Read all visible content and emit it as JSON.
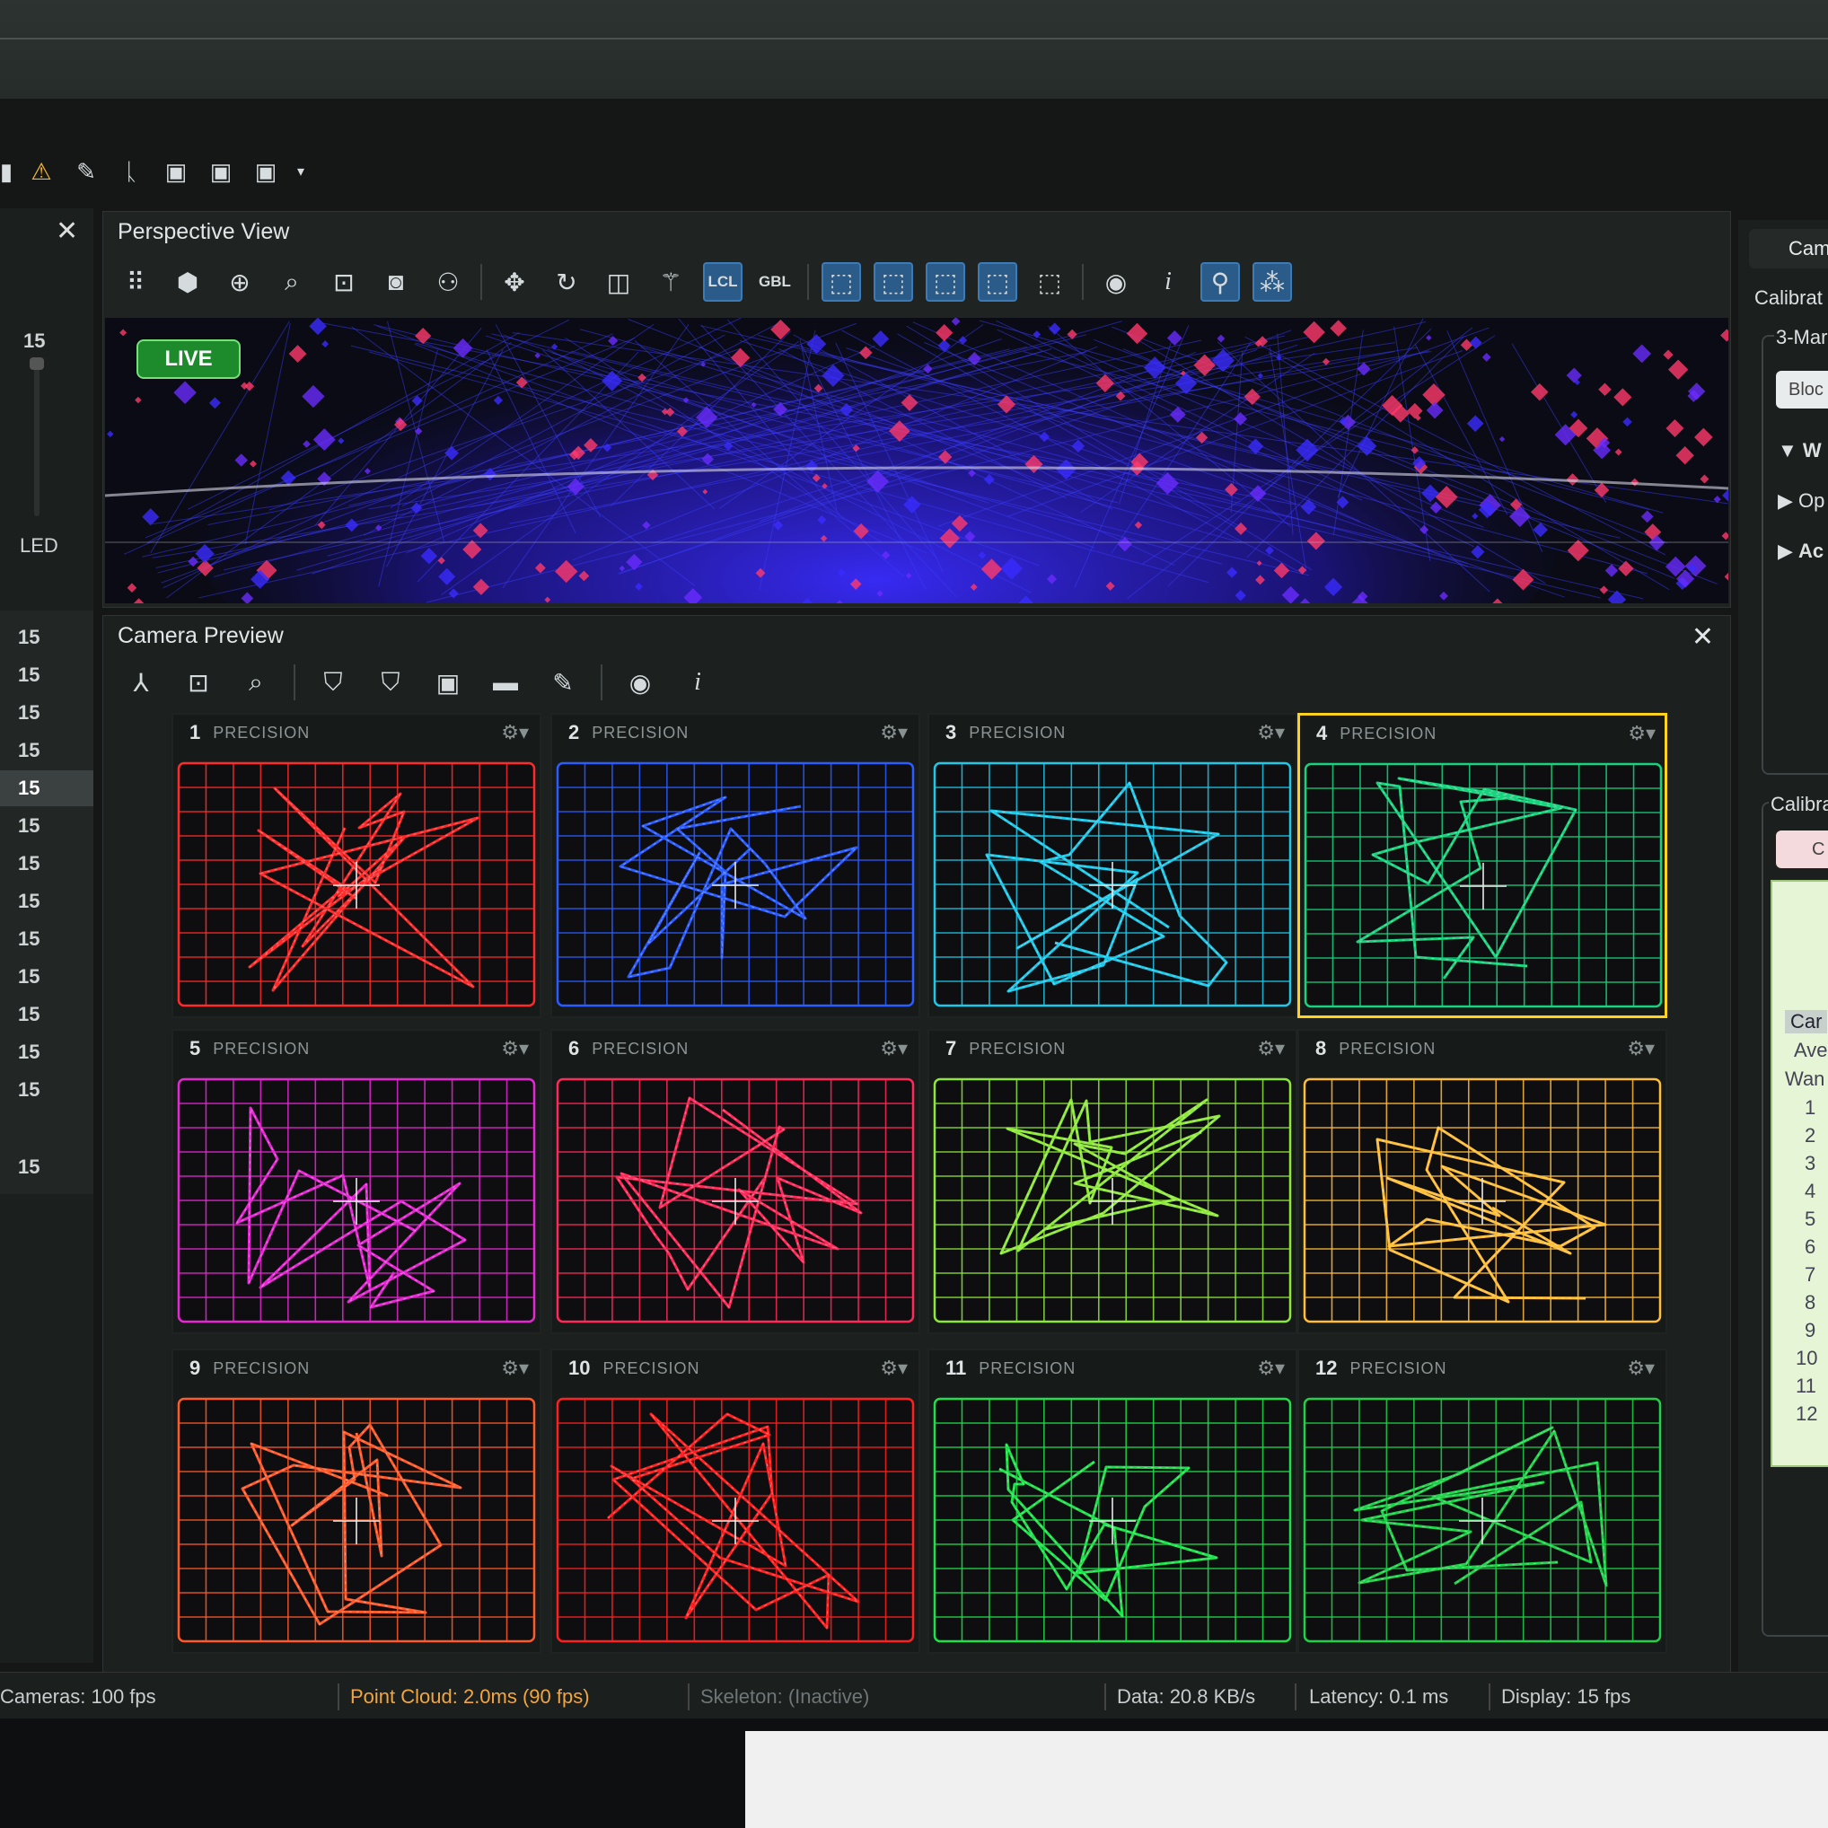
{
  "perspective": {
    "title": "Perspective View",
    "live": "LIVE",
    "lcl": "LCL",
    "gbl": "GBL"
  },
  "preview": {
    "title": "Camera Preview"
  },
  "left": {
    "top_value": "15",
    "led_label": "LED",
    "rows": [
      "15",
      "15",
      "15",
      "15",
      "15",
      "15",
      "15",
      "15",
      "15",
      "15",
      "15",
      "15",
      "15",
      "15"
    ],
    "selected_index": 4
  },
  "cameras": [
    {
      "num": "1",
      "mode": "PRECISION",
      "color": "#ff2a2a"
    },
    {
      "num": "2",
      "mode": "PRECISION",
      "color": "#2a5cff"
    },
    {
      "num": "3",
      "mode": "PRECISION",
      "color": "#1ec8e8"
    },
    {
      "num": "4",
      "mode": "PRECISION",
      "color": "#18d27e"
    },
    {
      "num": "5",
      "mode": "PRECISION",
      "color": "#e628d4"
    },
    {
      "num": "6",
      "mode": "PRECISION",
      "color": "#ff2a5a"
    },
    {
      "num": "7",
      "mode": "PRECISION",
      "color": "#8ee83a"
    },
    {
      "num": "8",
      "mode": "PRECISION",
      "color": "#ffbe3a"
    },
    {
      "num": "9",
      "mode": "PRECISION",
      "color": "#ff5a2a"
    },
    {
      "num": "10",
      "mode": "PRECISION",
      "color": "#ff2020"
    },
    {
      "num": "11",
      "mode": "PRECISION",
      "color": "#1ee04a"
    },
    {
      "num": "12",
      "mode": "PRECISION",
      "color": "#20d24a"
    }
  ],
  "selected_camera": 4,
  "right": {
    "tab": "Came",
    "calib1": "Calibrat",
    "group": "3-Mar",
    "btn1": "Bloc",
    "items": [
      "W",
      "Op",
      "Ac"
    ],
    "calib2": "Calibra",
    "btn2": "C",
    "list_header": "Car",
    "list_rows": [
      "Ave",
      "Wan"
    ],
    "list_nums": [
      "1",
      "2",
      "3",
      "4",
      "5",
      "6",
      "7",
      "8",
      "9",
      "10",
      "11",
      "12"
    ]
  },
  "status": {
    "cameras": "Cameras: 100 fps",
    "point_cloud": "Point Cloud: 2.0ms (90 fps)",
    "skeleton": "Skeleton: (Inactive)",
    "data": "Data: 20.8 KB/s",
    "latency": "Latency: 0.1 ms",
    "display": "Display: 15 fps"
  }
}
